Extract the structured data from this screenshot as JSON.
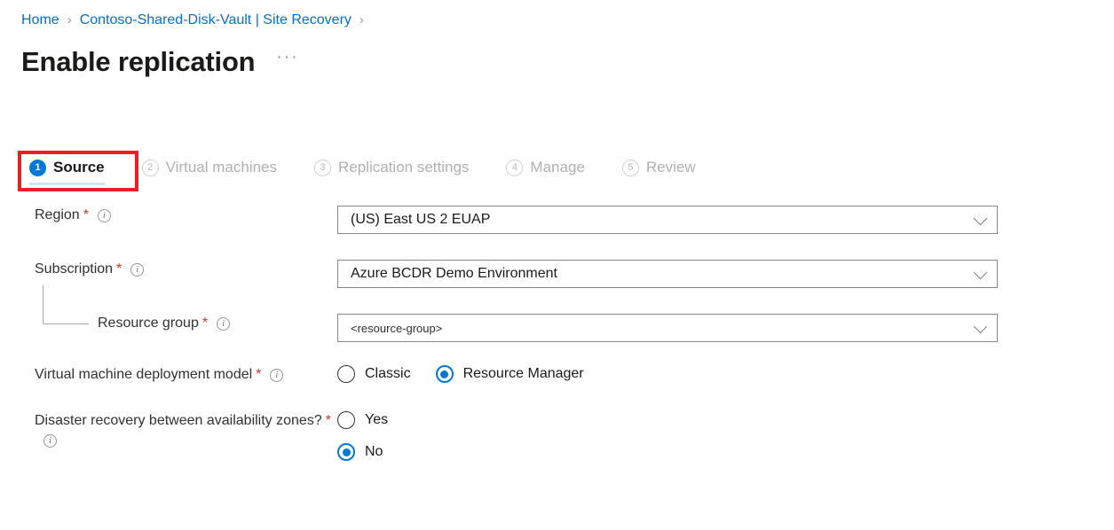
{
  "breadcrumb": {
    "separator": "›",
    "items": [
      {
        "label": "Home"
      },
      {
        "label": "Contoso-Shared-Disk-Vault | Site Recovery"
      }
    ]
  },
  "header": {
    "title": "Enable replication",
    "more_menu": "···"
  },
  "colors": {
    "accent_blue": "#0078d4",
    "link_blue": "#0a70c5",
    "annotation_red": "#ee1c25",
    "required_red": "#c0392b",
    "inactive_grey": "#b0b0b0",
    "tab_underline": "#cfe4f7"
  },
  "wizard_tabs": [
    {
      "number": "1",
      "label": "Source",
      "state": "active"
    },
    {
      "number": "2",
      "label": "Virtual machines",
      "state": "inactive"
    },
    {
      "number": "3",
      "label": "Replication settings",
      "state": "inactive"
    },
    {
      "number": "4",
      "label": "Manage",
      "state": "inactive"
    },
    {
      "number": "5",
      "label": "Review",
      "state": "inactive"
    }
  ],
  "annotation": {
    "target": "Source",
    "shape": "rectangle",
    "color": "#ee1c25"
  },
  "form": {
    "required_marker": "*",
    "info_glyph": "i",
    "fields": {
      "region": {
        "label": "Region",
        "value": "(US) East US 2 EUAP"
      },
      "subscription": {
        "label": "Subscription",
        "value": "Azure BCDR Demo Environment"
      },
      "resource_group": {
        "label": "Resource group",
        "value": "<resource-group>"
      },
      "deployment_model": {
        "label": "Virtual machine deployment model",
        "options": [
          {
            "label": "Classic",
            "selected": false
          },
          {
            "label": "Resource Manager",
            "selected": true
          }
        ]
      },
      "availability_zones": {
        "label": "Disaster recovery between availability zones?",
        "options": [
          {
            "label": "Yes",
            "selected": false
          },
          {
            "label": "No",
            "selected": true
          }
        ]
      }
    }
  }
}
